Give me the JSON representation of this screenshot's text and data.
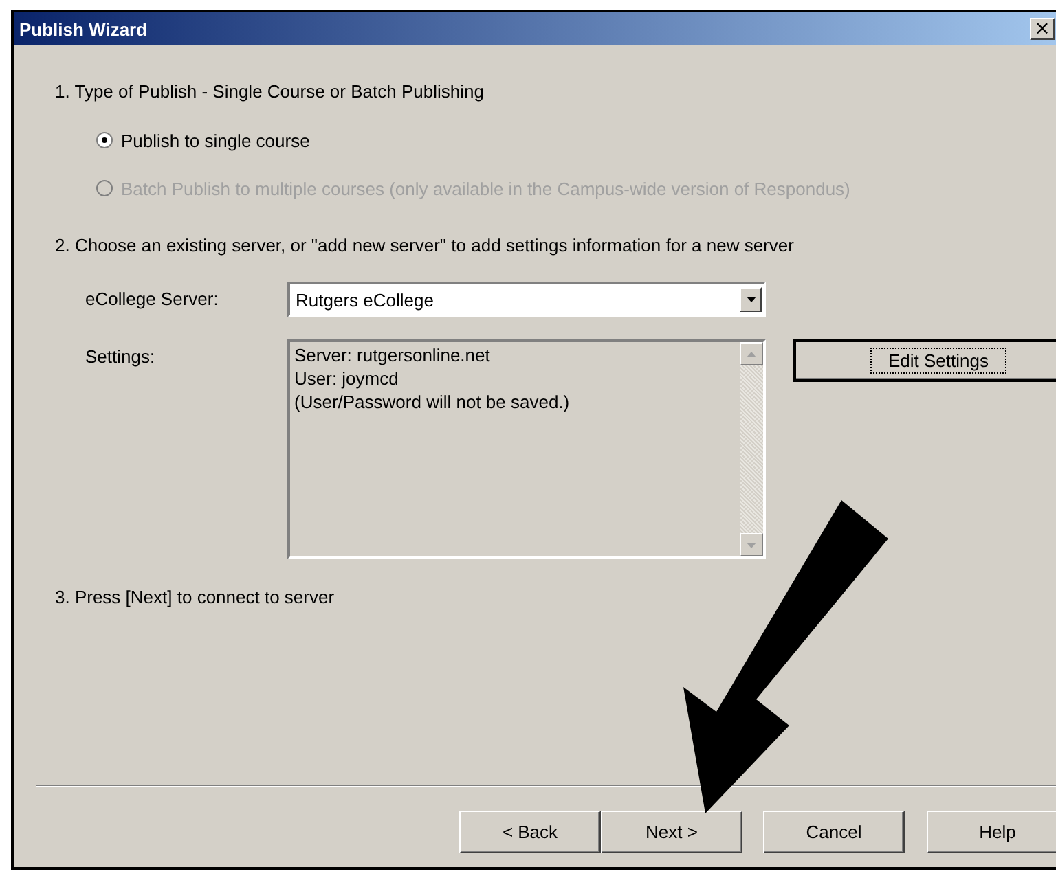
{
  "window": {
    "title": "Publish Wizard",
    "close": "×"
  },
  "steps": [
    {
      "kind": "radios",
      "heading": "1.  Type of Publish - Single Course or Batch Publishing",
      "options": [
        {
          "label": "Publish to single course",
          "selected": true,
          "disabled": false
        },
        {
          "label": "Batch Publish to multiple courses (only available in the Campus-wide version of Respondus)",
          "selected": false,
          "disabled": true
        }
      ]
    },
    {
      "kind": "server",
      "heading": "2.  Choose an existing server, or \"add new server\" to add settings information for a new server",
      "server_label": "eCollege Server:",
      "server_value": "Rutgers eCollege",
      "settings_label": "Settings:",
      "settings_lines": [
        "Server: rutgersonline.net",
        "User: joymcd",
        "(User/Password will not be saved.)"
      ],
      "edit_button": "Edit Settings"
    },
    {
      "kind": "text",
      "heading": "3.  Press [Next] to connect to server"
    }
  ],
  "buttons": [
    {
      "label": "< Back"
    },
    {
      "label": "Next >"
    },
    {
      "label": "Cancel"
    },
    {
      "label": "Help"
    }
  ]
}
